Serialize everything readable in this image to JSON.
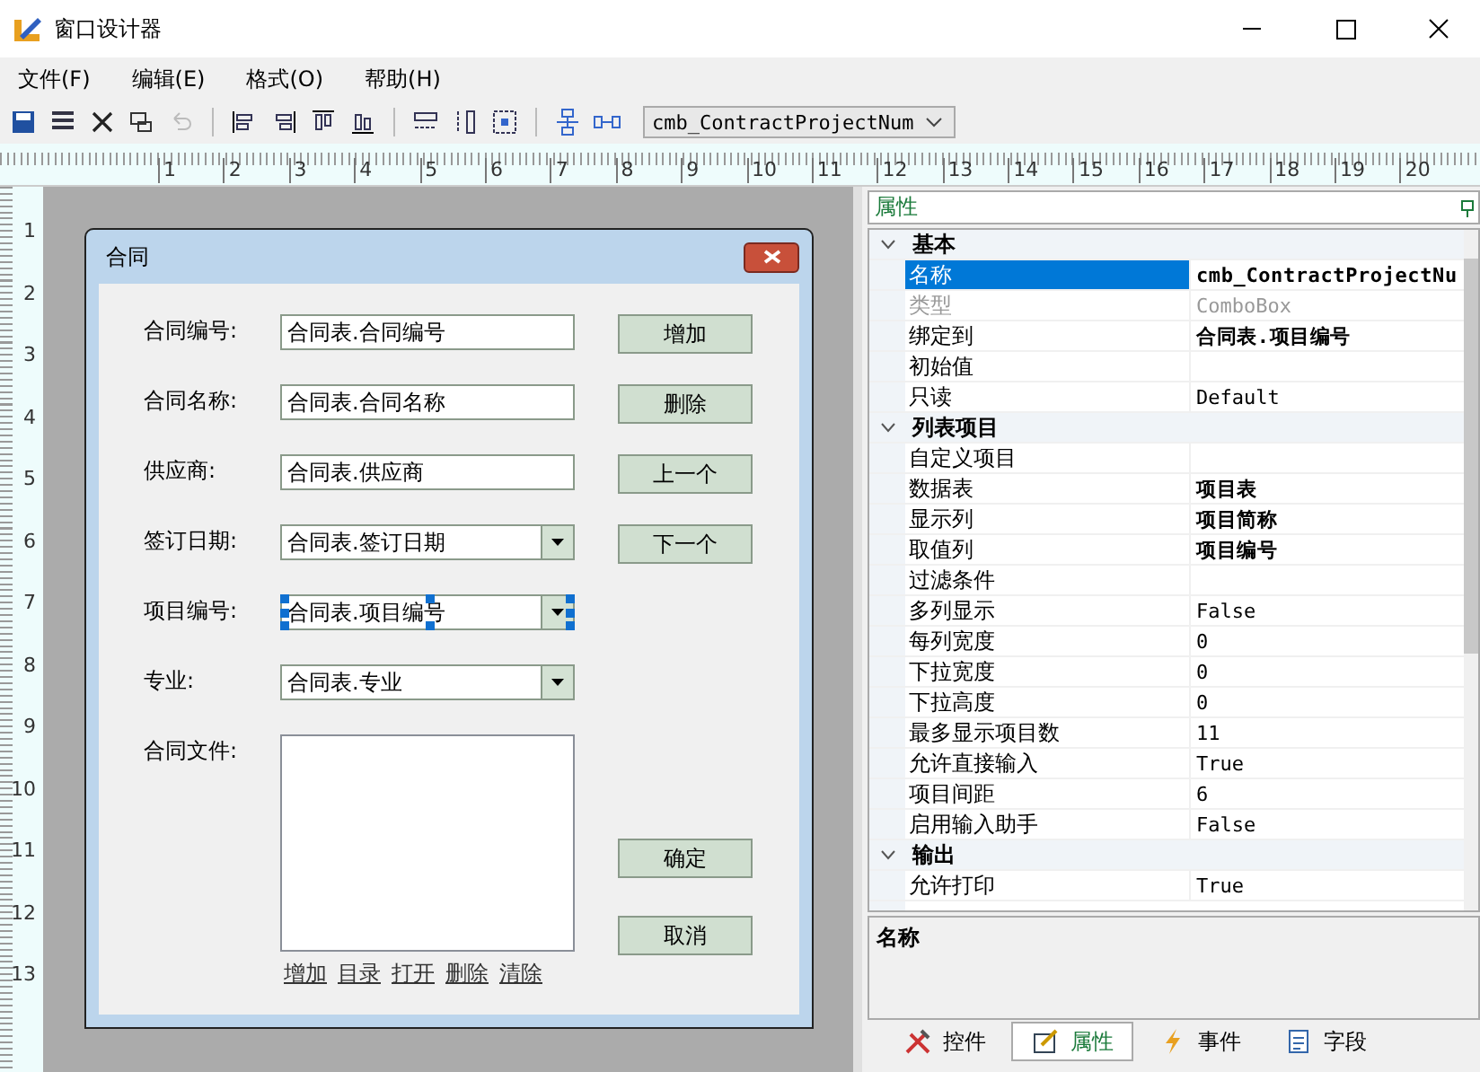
{
  "window": {
    "title": "窗口设计器"
  },
  "menu": [
    "文件(F)",
    "编辑(E)",
    "格式(O)",
    "帮助(H)"
  ],
  "toolbar": {
    "object_select": "cmb_ContractProjectNum"
  },
  "ruler": {
    "horizontal": [
      "1",
      "2",
      "3",
      "4",
      "5",
      "6",
      "7",
      "8",
      "9",
      "10",
      "11",
      "12",
      "13",
      "14",
      "15",
      "16",
      "17",
      "18",
      "19",
      "20"
    ],
    "vertical": [
      "1",
      "2",
      "3",
      "4",
      "5",
      "6",
      "7",
      "8",
      "9",
      "10",
      "11",
      "12",
      "13"
    ]
  },
  "form": {
    "title": "合同",
    "fields": [
      {
        "label": "合同编号:",
        "value": "合同表.合同编号",
        "kind": "text",
        "selected": false,
        "button": "增加"
      },
      {
        "label": "合同名称:",
        "value": "合同表.合同名称",
        "kind": "text",
        "selected": false,
        "button": "删除"
      },
      {
        "label": "供应商:",
        "value": "合同表.供应商",
        "kind": "text",
        "selected": false,
        "button": "上一个"
      },
      {
        "label": "签订日期:",
        "value": "合同表.签订日期",
        "kind": "combo",
        "selected": false,
        "button": "下一个"
      },
      {
        "label": "项目编号:",
        "value": "合同表.项目编号",
        "kind": "combo",
        "selected": true
      },
      {
        "label": "专业:",
        "value": "合同表.专业",
        "kind": "combo",
        "selected": false
      }
    ],
    "file_label": "合同文件:",
    "file_links": [
      "增加",
      "目录",
      "打开",
      "删除",
      "清除"
    ],
    "buttons": [
      "确定",
      "取消"
    ]
  },
  "properties": {
    "header": "属性",
    "categories": [
      {
        "name": "基本",
        "expanded": true,
        "rows": [
          {
            "name": "名称",
            "value": "cmb_ContractProjectNu",
            "bold": true,
            "disabled": false,
            "selected": true
          },
          {
            "name": "类型",
            "value": "ComboBox",
            "bold": false,
            "disabled": true,
            "selected": false
          },
          {
            "name": "绑定到",
            "value": "合同表.项目编号",
            "bold": true,
            "disabled": false,
            "selected": false
          },
          {
            "name": "初始值",
            "value": "",
            "disabled": false,
            "selected": false
          },
          {
            "name": "只读",
            "value": "Default",
            "bold": false,
            "disabled": false,
            "selected": false
          }
        ]
      },
      {
        "name": "列表项目",
        "expanded": true,
        "rows": [
          {
            "name": "自定义项目",
            "value": "",
            "disabled": false,
            "selected": false
          },
          {
            "name": "数据表",
            "value": "项目表",
            "bold": true,
            "disabled": false,
            "selected": false
          },
          {
            "name": "显示列",
            "value": "项目简称",
            "bold": true,
            "disabled": false,
            "selected": false
          },
          {
            "name": "取值列",
            "value": "项目编号",
            "bold": true,
            "disabled": false,
            "selected": false
          },
          {
            "name": "过滤条件",
            "value": "",
            "disabled": false,
            "selected": false
          },
          {
            "name": "多列显示",
            "value": "False",
            "bold": false,
            "disabled": false,
            "selected": false
          },
          {
            "name": "每列宽度",
            "value": "0",
            "bold": false,
            "disabled": false,
            "selected": false
          },
          {
            "name": "下拉宽度",
            "value": "0",
            "bold": false,
            "disabled": false,
            "selected": false
          },
          {
            "name": "下拉高度",
            "value": "0",
            "bold": false,
            "disabled": false,
            "selected": false
          },
          {
            "name": "最多显示项目数",
            "value": "11",
            "bold": false,
            "disabled": false,
            "selected": false
          },
          {
            "name": "允许直接输入",
            "value": "True",
            "bold": false,
            "disabled": false,
            "selected": false
          },
          {
            "name": "项目间距",
            "value": "6",
            "bold": false,
            "disabled": false,
            "selected": false
          },
          {
            "name": "启用输入助手",
            "value": "False",
            "bold": false,
            "disabled": false,
            "selected": false
          }
        ]
      },
      {
        "name": "输出",
        "expanded": true,
        "rows": [
          {
            "name": "允许打印",
            "value": "True",
            "bold": false,
            "disabled": false,
            "selected": false
          }
        ]
      }
    ],
    "description": "名称",
    "tabs": [
      {
        "label": "控件",
        "kind": "tools",
        "selected": false
      },
      {
        "label": "属性",
        "kind": "props",
        "selected": true
      },
      {
        "label": "事件",
        "kind": "events",
        "selected": false
      },
      {
        "label": "字段",
        "kind": "fields",
        "selected": false
      }
    ]
  }
}
